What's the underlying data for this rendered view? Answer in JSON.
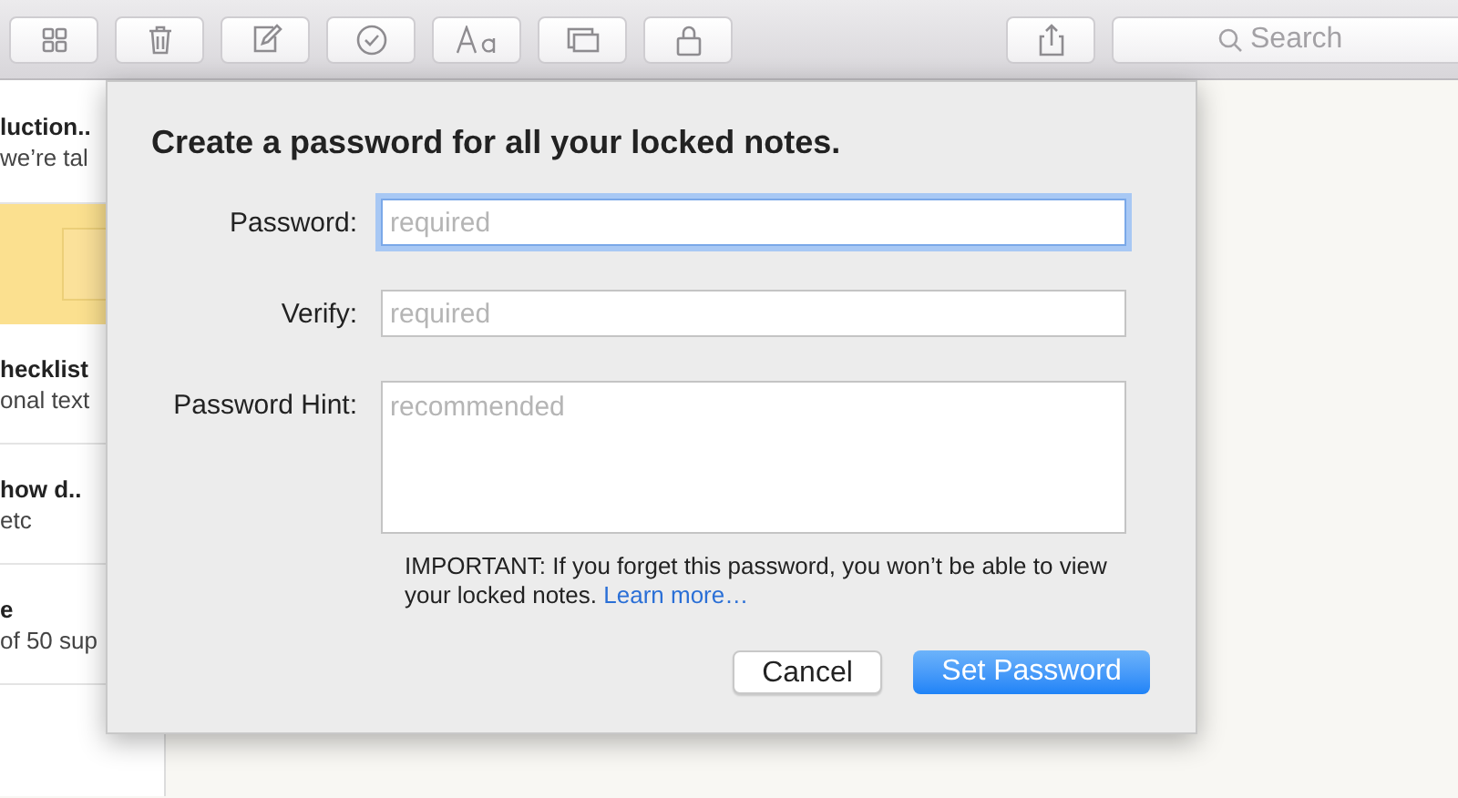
{
  "toolbar": {
    "search": {
      "placeholder": "Search"
    }
  },
  "notes": [
    {
      "title": "luction..",
      "snippet": "we’re tal",
      "selected": false
    },
    {
      "selected": true
    },
    {
      "title": "hecklist",
      "snippet": "onal text",
      "selected": false
    },
    {
      "title": "how d..",
      "snippet": "etc",
      "selected": false
    },
    {
      "title": "e",
      "snippet": "of 50 sup",
      "selected": false
    }
  ],
  "dialog": {
    "title": "Create a password for all your locked notes.",
    "fields": [
      {
        "label": "Password:",
        "placeholder": "required",
        "kind": "line",
        "focused": true
      },
      {
        "label": "Verify:",
        "placeholder": "required",
        "kind": "line",
        "focused": false
      },
      {
        "label": "Password Hint:",
        "placeholder": "recommended",
        "kind": "area",
        "focused": false
      }
    ],
    "note": "IMPORTANT: If you forget this password, you won’t be able to view your locked notes.",
    "link": "Learn more…",
    "buttons": [
      {
        "label": "Cancel",
        "default": false
      },
      {
        "label": "Set Password",
        "default": true
      }
    ]
  }
}
